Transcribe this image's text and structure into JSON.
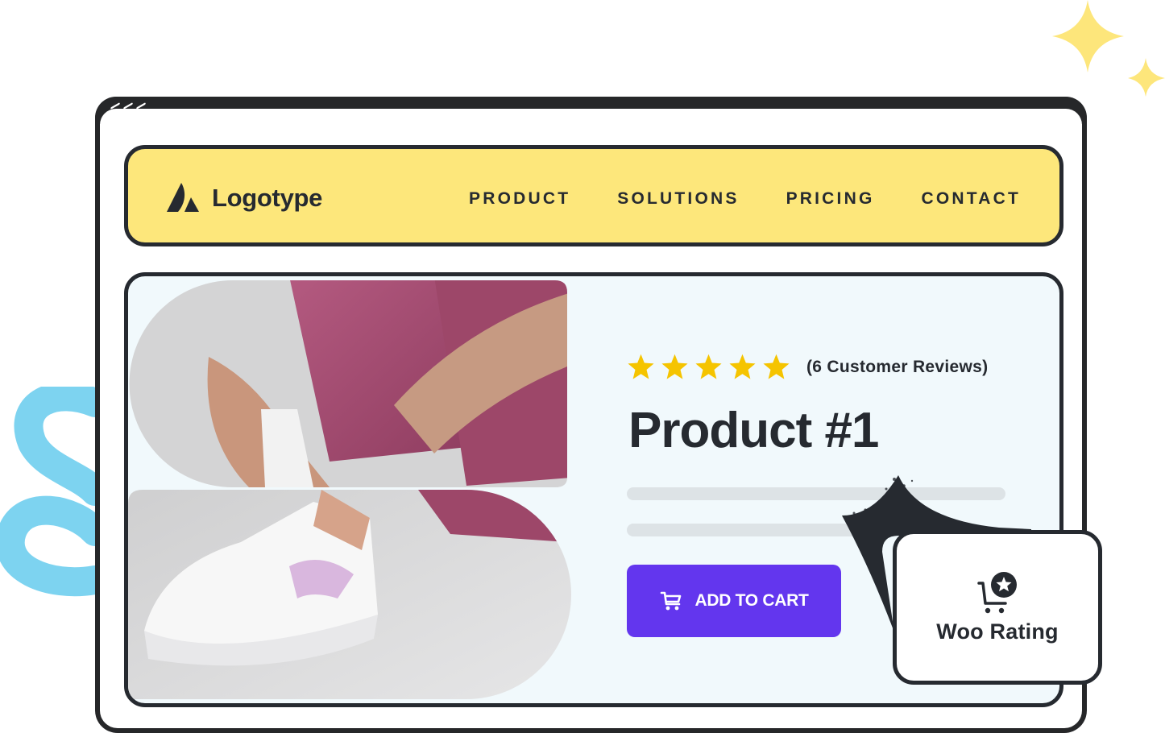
{
  "decorations": {
    "sparkle_color": "#fde67b",
    "squiggle_color": "#7dd3f0"
  },
  "browser": {
    "frame_color": "#262729"
  },
  "navbar": {
    "background": "#fde77b",
    "logo": {
      "icon": "logo-mark-icon",
      "text": "Logotype"
    },
    "links": [
      {
        "label": "PRODUCT"
      },
      {
        "label": "SOLUTIONS"
      },
      {
        "label": "PRICING"
      },
      {
        "label": "CONTACT"
      }
    ]
  },
  "product": {
    "image_alt": "Person tying laces of white sneaker, pink leggings, tattooed forearm",
    "rating": {
      "stars": 5,
      "max": 5,
      "color": "#f5c400"
    },
    "reviews_text": "(6 Customer Reviews)",
    "title": "Product #1",
    "add_to_cart": {
      "label": "ADD TO CART",
      "icon": "cart-icon",
      "color": "#6336ee"
    }
  },
  "woo_card": {
    "icon": "cart-star-icon",
    "label": "Woo Rating"
  }
}
